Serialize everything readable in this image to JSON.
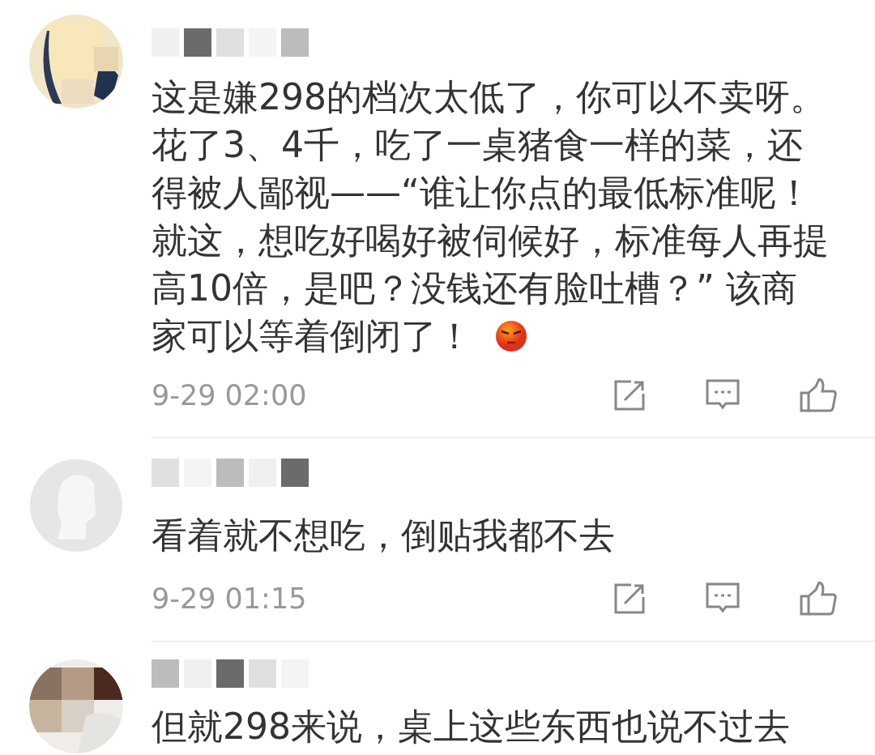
{
  "comments": [
    {
      "lines": [
        "这是嫌298的档次太低了，你可以不卖呀。",
        "花了3、4千，吃了一桌猪食一样的菜，还",
        "得被人鄙视——“谁让你点的最低标准呢！",
        "就这，想吃好喝好被伺候好，标准每人再提",
        "高10倍，是吧？没钱还有脸吐槽？” 该商",
        "家可以等着倒闭了！"
      ],
      "angry_emoji": true,
      "date": "9-29 02:00"
    },
    {
      "kind": "default",
      "lines": [
        "看着就不想吃，倒贴我都不去"
      ],
      "angry_emoji": false,
      "date": "9-29 01:15"
    },
    {
      "lines": [
        "但就298来说，桌上这些东西也说不过去"
      ],
      "angry_emoji": false
    }
  ]
}
